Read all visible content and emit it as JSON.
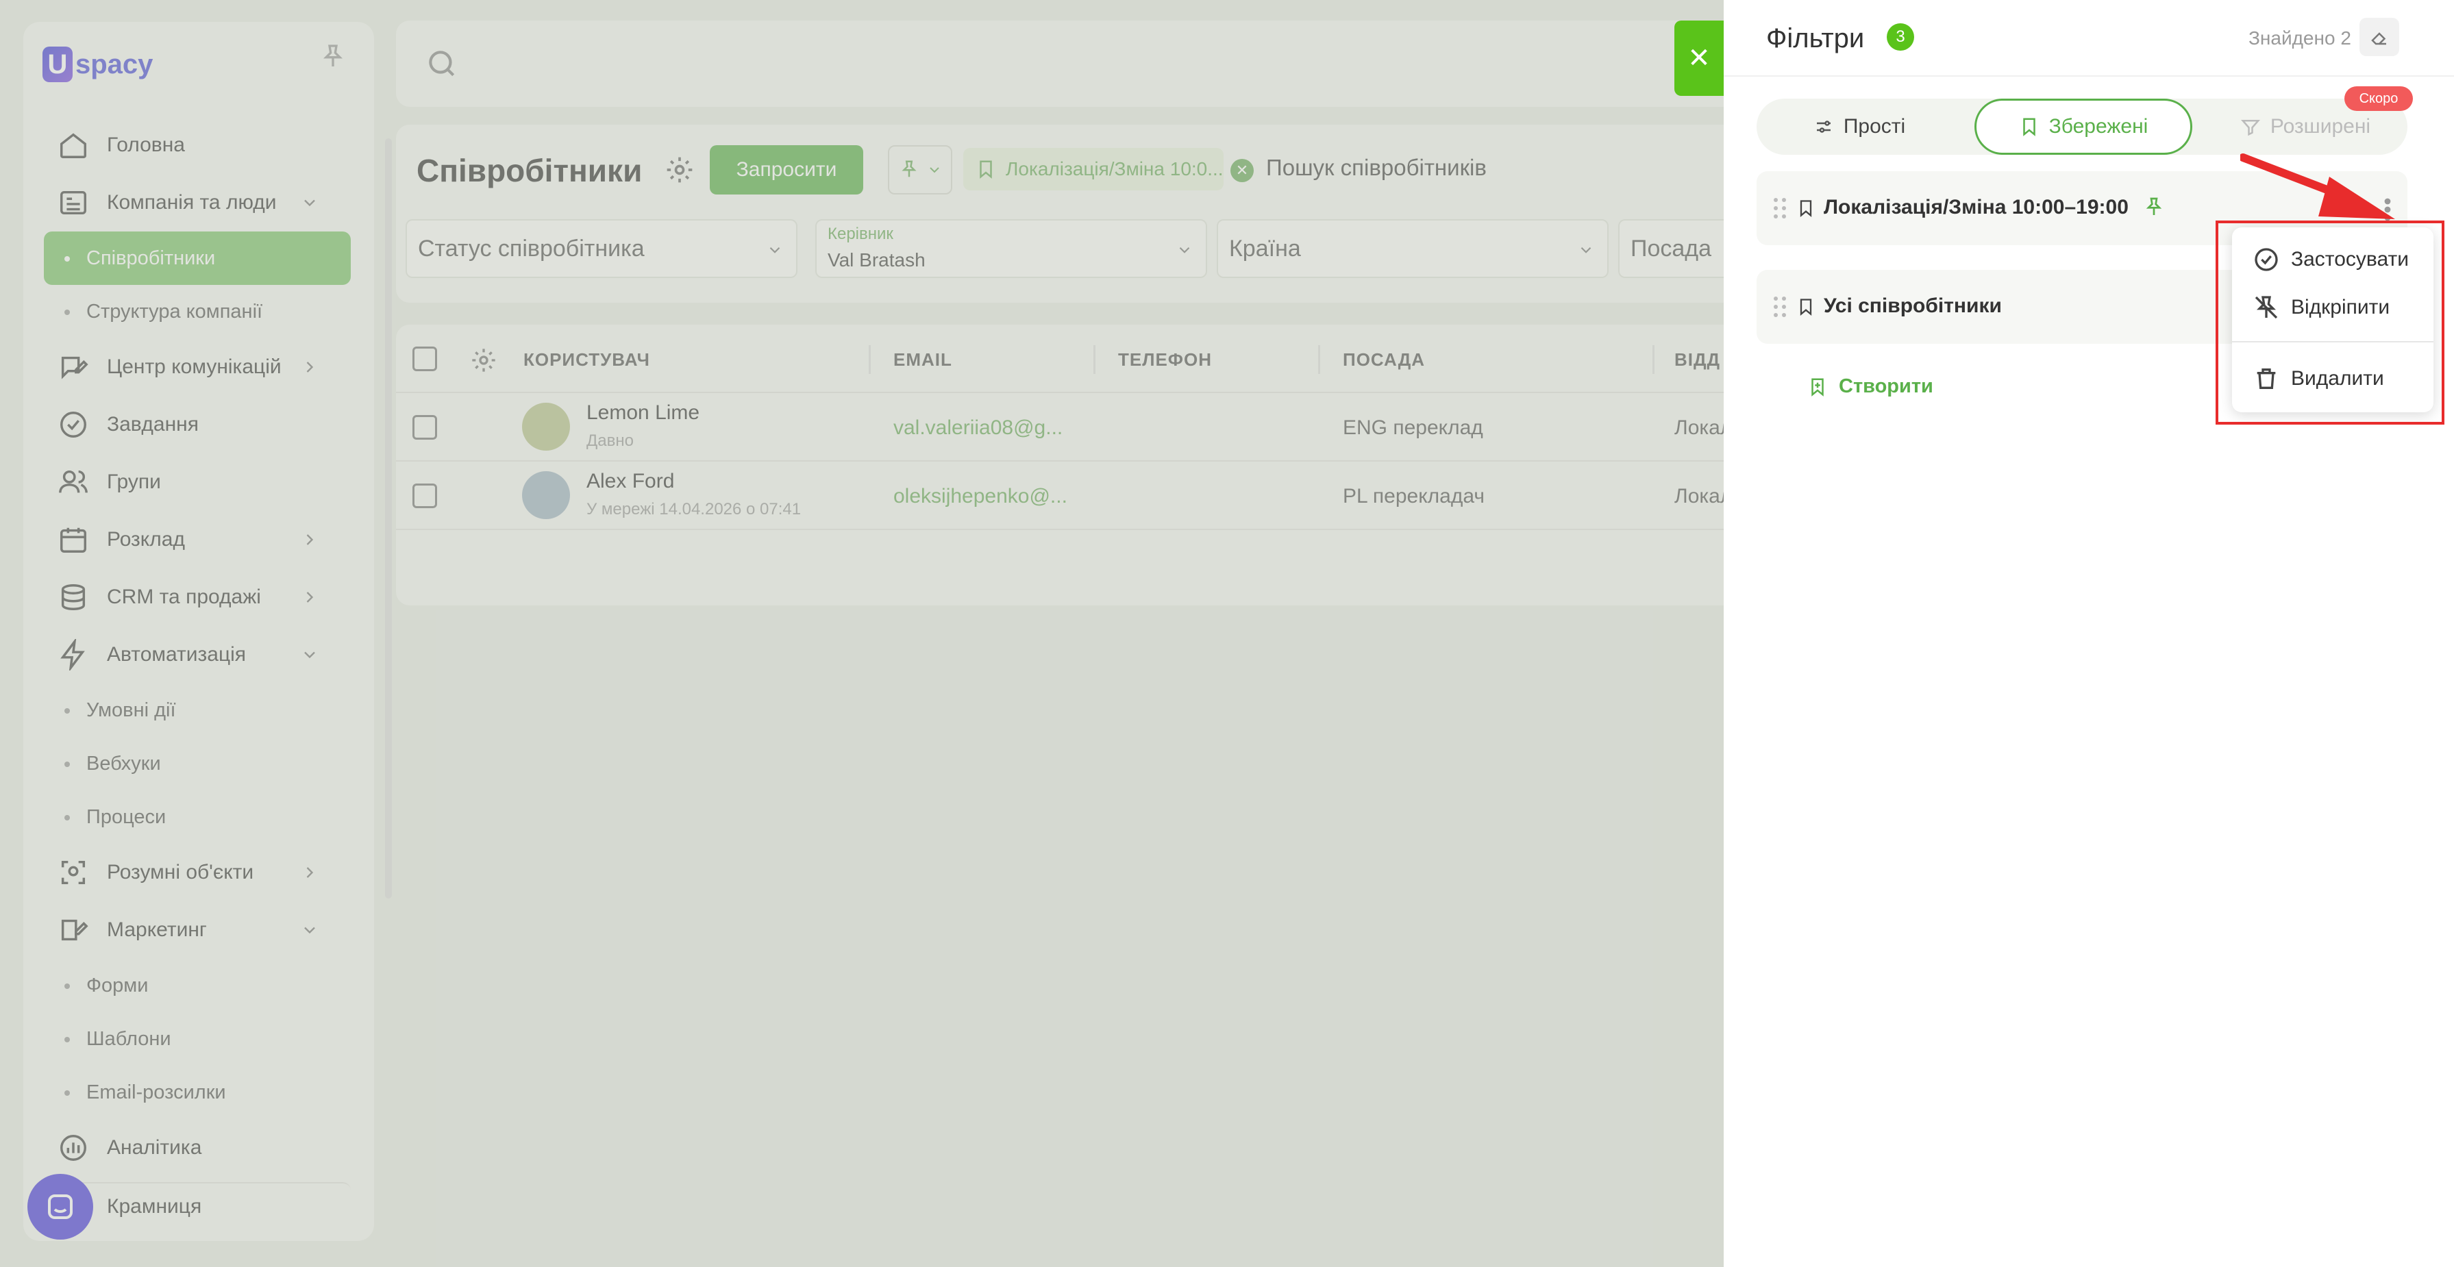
{
  "logo": {
    "text": "spacy",
    "mark": "U"
  },
  "sidebar": {
    "items": [
      {
        "label": "Головна",
        "icon": "home-icon"
      },
      {
        "label": "Компанія та люди",
        "icon": "company-icon",
        "chevron": "chevron-down"
      },
      {
        "label": "Співробітники",
        "sub": true,
        "active": true
      },
      {
        "label": "Структура компанії",
        "sub": true
      },
      {
        "label": "Центр комунікацій",
        "icon": "chat-edit-icon",
        "chevron": "chevron-right"
      },
      {
        "label": "Завдання",
        "icon": "check-circle-icon"
      },
      {
        "label": "Групи",
        "icon": "users-icon"
      },
      {
        "label": "Розклад",
        "icon": "calendar-icon",
        "chevron": "chevron-right"
      },
      {
        "label": "CRM та продажі",
        "icon": "database-icon",
        "chevron": "chevron-right"
      },
      {
        "label": "Автоматизація",
        "icon": "lightning-icon",
        "chevron": "chevron-down"
      },
      {
        "label": "Умовні дії",
        "sub": true
      },
      {
        "label": "Вебхуки",
        "sub": true
      },
      {
        "label": "Процеси",
        "sub": true
      },
      {
        "label": "Розумні об'єкти",
        "icon": "scan-icon",
        "chevron": "chevron-right"
      },
      {
        "label": "Маркетинг",
        "icon": "marketing-icon",
        "chevron": "chevron-down"
      },
      {
        "label": "Форми",
        "sub": true
      },
      {
        "label": "Шаблони",
        "sub": true
      },
      {
        "label": "Email-розсилки",
        "sub": true
      },
      {
        "label": "Аналітика",
        "icon": "chart-icon"
      },
      {
        "label": "Крамниця",
        "icon": "shop-icon"
      }
    ]
  },
  "main": {
    "title": "Співробітники",
    "invite_label": "Запросити",
    "chip_label": "Локалізація/Зміна 10:0...",
    "search_placeholder": "Пошук співробітників",
    "filters": {
      "status": "Статус співробітника",
      "manager_label": "Керівник",
      "manager_value": "Val Bratash",
      "country": "Країна",
      "position": "Посада"
    }
  },
  "table": {
    "headers": [
      "КОРИСТУВАЧ",
      "EMAIL",
      "ТЕЛЕФОН",
      "ПОСАДА",
      "ВІДД"
    ],
    "rows": [
      {
        "name": "Lemon Lime",
        "status": "Давно",
        "email": "val.valeriia08@g...",
        "phone": "",
        "position": "ENG переклад",
        "dept": "Локаліз"
      },
      {
        "name": "Alex Ford",
        "status": "У мережі 14.04.2026 о 07:41",
        "email": "oleksijhepenko@...",
        "phone": "",
        "position": "PL перекладач",
        "dept": "Локаліз"
      }
    ]
  },
  "panel": {
    "title": "Фільтри",
    "count": "3",
    "found": "Знайдено 2",
    "tabs": [
      "Прості",
      "Збережені",
      "Розширені"
    ],
    "soon": "Скоро",
    "saved": [
      "Локалізація/Зміна 10:00–19:00",
      "Усі співробітники"
    ],
    "create_label": "Створити"
  },
  "context_menu": {
    "apply": "Застосувати",
    "unpin": "Відкріпити",
    "delete": "Видалити"
  },
  "colors": {
    "accent": "#5ab04a",
    "badge": "#5ac31a",
    "highlight": "#e82c2c",
    "soon": "#f25a5a"
  }
}
